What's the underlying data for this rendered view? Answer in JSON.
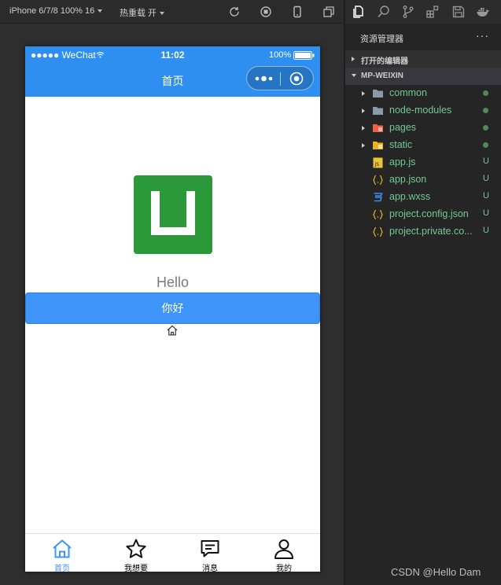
{
  "toolbar": {
    "device": "iPhone 6/7/8 100% 16",
    "hot_reload": "热重载 开",
    "icons": [
      "refresh-icon",
      "stop-icon",
      "phone-icon",
      "window-icon"
    ]
  },
  "phone": {
    "status": {
      "carrier": "●●●●● WeChat",
      "time": "11:02",
      "battery": "100%"
    },
    "nav_title": "首页",
    "hello": "Hello",
    "button_label": "你好",
    "tabs": [
      {
        "label": "首页",
        "icon": "home-icon",
        "active": true
      },
      {
        "label": "我想要",
        "icon": "star-icon",
        "active": false
      },
      {
        "label": "消息",
        "icon": "message-icon",
        "active": false
      },
      {
        "label": "我的",
        "icon": "user-icon",
        "active": false
      }
    ],
    "colors": {
      "primary": "#2f8ff0",
      "button": "#3f94f7",
      "logo": "#2b9939"
    }
  },
  "explorer": {
    "title": "资源管理器",
    "more": "···",
    "open_editors": "打开的编辑器",
    "project": "MP-WEIXIN",
    "items": [
      {
        "name": "common",
        "type": "folder",
        "status": ""
      },
      {
        "name": "node-modules",
        "type": "folder",
        "status": ""
      },
      {
        "name": "pages",
        "type": "folder-pages",
        "status": ""
      },
      {
        "name": "static",
        "type": "folder-static",
        "status": ""
      },
      {
        "name": "app.js",
        "type": "js",
        "status": "U"
      },
      {
        "name": "app.json",
        "type": "json",
        "status": "U"
      },
      {
        "name": "app.wxss",
        "type": "css",
        "status": "U"
      },
      {
        "name": "project.config.json",
        "type": "json",
        "status": "U"
      },
      {
        "name": "project.private.co...",
        "type": "json",
        "status": "U"
      }
    ]
  },
  "watermark": "CSDN @Hello Dam"
}
